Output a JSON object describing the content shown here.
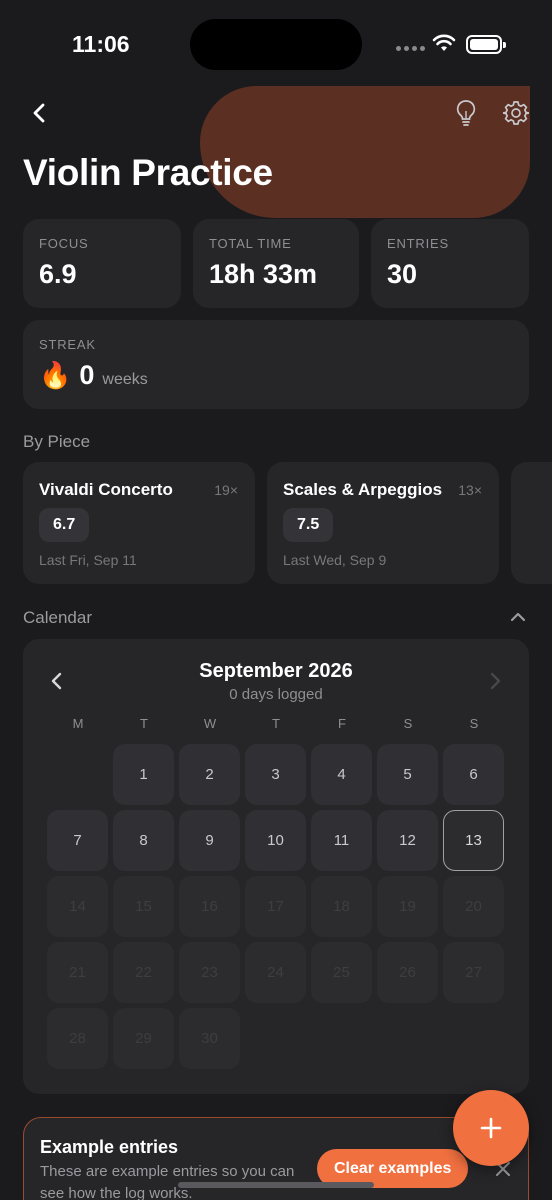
{
  "status_bar": {
    "time": "11:06"
  },
  "header": {
    "title": "Violin Practice"
  },
  "stats": [
    {
      "label": "FOCUS",
      "value": "6.9"
    },
    {
      "label": "TOTAL TIME",
      "value": "18h 33m"
    },
    {
      "label": "ENTRIES",
      "value": "30"
    }
  ],
  "streak": {
    "label": "STREAK",
    "icon": "🔥",
    "value": "0",
    "unit": "weeks"
  },
  "by_piece": {
    "heading": "By Piece",
    "items": [
      {
        "name": "Vivaldi Concerto",
        "count": "19×",
        "score": "6.7",
        "last": "Last Fri, Sep 11"
      },
      {
        "name": "Scales & Arpeggios",
        "count": "13×",
        "score": "7.5",
        "last": "Last Wed, Sep 9"
      }
    ]
  },
  "calendar": {
    "heading": "Calendar",
    "month": "September 2026",
    "subtitle": "0 days logged",
    "weekdays": [
      "M",
      "T",
      "W",
      "T",
      "F",
      "S",
      "S"
    ],
    "days": [
      "1",
      "2",
      "3",
      "4",
      "5",
      "6",
      "7",
      "8",
      "9",
      "10",
      "11",
      "12",
      "13",
      "14",
      "15",
      "16",
      "17",
      "18",
      "19",
      "20",
      "21",
      "22",
      "23",
      "24",
      "25",
      "26",
      "27",
      "28",
      "29",
      "30"
    ],
    "today": "13"
  },
  "example_banner": {
    "title": "Example entries",
    "description": "These are example entries so you can see how the log works.",
    "button": "Clear examples"
  },
  "colors": {
    "accent": "#f07040",
    "background": "#1b1b1e",
    "card": "#262629",
    "header_blob": "#5c2f23"
  }
}
